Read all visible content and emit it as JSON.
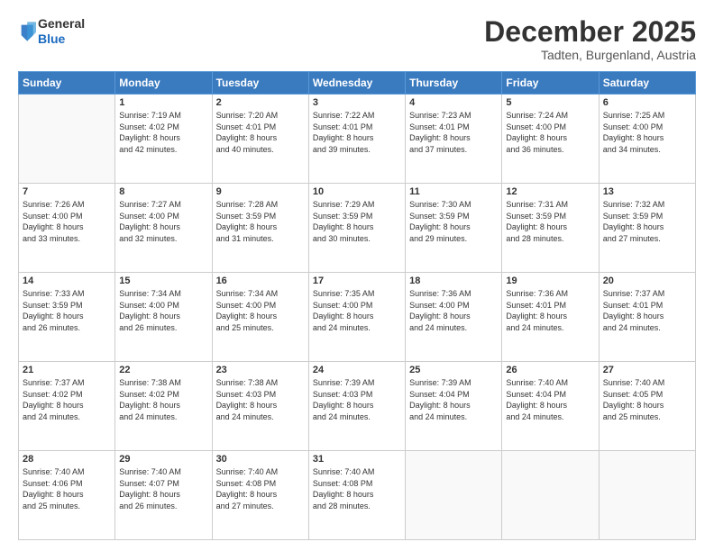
{
  "header": {
    "logo_general": "General",
    "logo_blue": "Blue",
    "month_title": "December 2025",
    "subtitle": "Tadten, Burgenland, Austria"
  },
  "weekdays": [
    "Sunday",
    "Monday",
    "Tuesday",
    "Wednesday",
    "Thursday",
    "Friday",
    "Saturday"
  ],
  "weeks": [
    [
      {
        "day": "",
        "info": ""
      },
      {
        "day": "1",
        "info": "Sunrise: 7:19 AM\nSunset: 4:02 PM\nDaylight: 8 hours\nand 42 minutes."
      },
      {
        "day": "2",
        "info": "Sunrise: 7:20 AM\nSunset: 4:01 PM\nDaylight: 8 hours\nand 40 minutes."
      },
      {
        "day": "3",
        "info": "Sunrise: 7:22 AM\nSunset: 4:01 PM\nDaylight: 8 hours\nand 39 minutes."
      },
      {
        "day": "4",
        "info": "Sunrise: 7:23 AM\nSunset: 4:01 PM\nDaylight: 8 hours\nand 37 minutes."
      },
      {
        "day": "5",
        "info": "Sunrise: 7:24 AM\nSunset: 4:00 PM\nDaylight: 8 hours\nand 36 minutes."
      },
      {
        "day": "6",
        "info": "Sunrise: 7:25 AM\nSunset: 4:00 PM\nDaylight: 8 hours\nand 34 minutes."
      }
    ],
    [
      {
        "day": "7",
        "info": "Sunrise: 7:26 AM\nSunset: 4:00 PM\nDaylight: 8 hours\nand 33 minutes."
      },
      {
        "day": "8",
        "info": "Sunrise: 7:27 AM\nSunset: 4:00 PM\nDaylight: 8 hours\nand 32 minutes."
      },
      {
        "day": "9",
        "info": "Sunrise: 7:28 AM\nSunset: 3:59 PM\nDaylight: 8 hours\nand 31 minutes."
      },
      {
        "day": "10",
        "info": "Sunrise: 7:29 AM\nSunset: 3:59 PM\nDaylight: 8 hours\nand 30 minutes."
      },
      {
        "day": "11",
        "info": "Sunrise: 7:30 AM\nSunset: 3:59 PM\nDaylight: 8 hours\nand 29 minutes."
      },
      {
        "day": "12",
        "info": "Sunrise: 7:31 AM\nSunset: 3:59 PM\nDaylight: 8 hours\nand 28 minutes."
      },
      {
        "day": "13",
        "info": "Sunrise: 7:32 AM\nSunset: 3:59 PM\nDaylight: 8 hours\nand 27 minutes."
      }
    ],
    [
      {
        "day": "14",
        "info": "Sunrise: 7:33 AM\nSunset: 3:59 PM\nDaylight: 8 hours\nand 26 minutes."
      },
      {
        "day": "15",
        "info": "Sunrise: 7:34 AM\nSunset: 4:00 PM\nDaylight: 8 hours\nand 26 minutes."
      },
      {
        "day": "16",
        "info": "Sunrise: 7:34 AM\nSunset: 4:00 PM\nDaylight: 8 hours\nand 25 minutes."
      },
      {
        "day": "17",
        "info": "Sunrise: 7:35 AM\nSunset: 4:00 PM\nDaylight: 8 hours\nand 24 minutes."
      },
      {
        "day": "18",
        "info": "Sunrise: 7:36 AM\nSunset: 4:00 PM\nDaylight: 8 hours\nand 24 minutes."
      },
      {
        "day": "19",
        "info": "Sunrise: 7:36 AM\nSunset: 4:01 PM\nDaylight: 8 hours\nand 24 minutes."
      },
      {
        "day": "20",
        "info": "Sunrise: 7:37 AM\nSunset: 4:01 PM\nDaylight: 8 hours\nand 24 minutes."
      }
    ],
    [
      {
        "day": "21",
        "info": "Sunrise: 7:37 AM\nSunset: 4:02 PM\nDaylight: 8 hours\nand 24 minutes."
      },
      {
        "day": "22",
        "info": "Sunrise: 7:38 AM\nSunset: 4:02 PM\nDaylight: 8 hours\nand 24 minutes."
      },
      {
        "day": "23",
        "info": "Sunrise: 7:38 AM\nSunset: 4:03 PM\nDaylight: 8 hours\nand 24 minutes."
      },
      {
        "day": "24",
        "info": "Sunrise: 7:39 AM\nSunset: 4:03 PM\nDaylight: 8 hours\nand 24 minutes."
      },
      {
        "day": "25",
        "info": "Sunrise: 7:39 AM\nSunset: 4:04 PM\nDaylight: 8 hours\nand 24 minutes."
      },
      {
        "day": "26",
        "info": "Sunrise: 7:40 AM\nSunset: 4:04 PM\nDaylight: 8 hours\nand 24 minutes."
      },
      {
        "day": "27",
        "info": "Sunrise: 7:40 AM\nSunset: 4:05 PM\nDaylight: 8 hours\nand 25 minutes."
      }
    ],
    [
      {
        "day": "28",
        "info": "Sunrise: 7:40 AM\nSunset: 4:06 PM\nDaylight: 8 hours\nand 25 minutes."
      },
      {
        "day": "29",
        "info": "Sunrise: 7:40 AM\nSunset: 4:07 PM\nDaylight: 8 hours\nand 26 minutes."
      },
      {
        "day": "30",
        "info": "Sunrise: 7:40 AM\nSunset: 4:08 PM\nDaylight: 8 hours\nand 27 minutes."
      },
      {
        "day": "31",
        "info": "Sunrise: 7:40 AM\nSunset: 4:08 PM\nDaylight: 8 hours\nand 28 minutes."
      },
      {
        "day": "",
        "info": ""
      },
      {
        "day": "",
        "info": ""
      },
      {
        "day": "",
        "info": ""
      }
    ]
  ]
}
